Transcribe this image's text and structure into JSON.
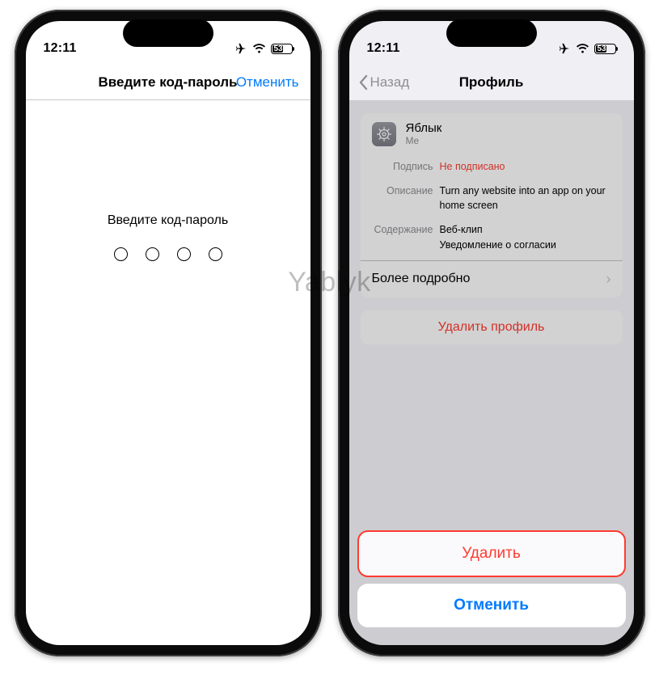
{
  "watermark": "Yablyk",
  "status": {
    "time": "12:11",
    "battery_percent": "53"
  },
  "left": {
    "nav_title": "Введите код-пароль",
    "cancel": "Отменить",
    "prompt": "Введите код-пароль"
  },
  "right": {
    "back": "Назад",
    "nav_title": "Профиль",
    "profile": {
      "name": "Яблык",
      "by": "Me",
      "rows": {
        "sig_label": "Подпись",
        "sig_value": "Не подписано",
        "desc_label": "Описание",
        "desc_value": "Turn any website into an app on your home screen",
        "cont_label": "Содержание",
        "cont_value1": "Веб-клип",
        "cont_value2": "Уведомление о согласии"
      },
      "more": "Более подробно",
      "delete": "Удалить профиль"
    },
    "sheet": {
      "delete": "Удалить",
      "cancel": "Отменить"
    }
  }
}
